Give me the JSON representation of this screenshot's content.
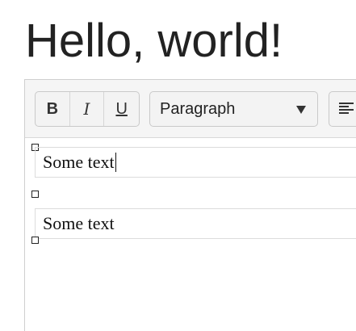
{
  "page": {
    "title": "Hello, world!"
  },
  "toolbar": {
    "bold_label": "B",
    "italic_label": "I",
    "underline_label": "U",
    "block_format_selected": "Paragraph",
    "align_icon": "align-left-icon"
  },
  "content": {
    "paragraphs": [
      {
        "text": "Some text"
      },
      {
        "text": "Some text"
      }
    ],
    "caret_after_paragraph": 1
  }
}
